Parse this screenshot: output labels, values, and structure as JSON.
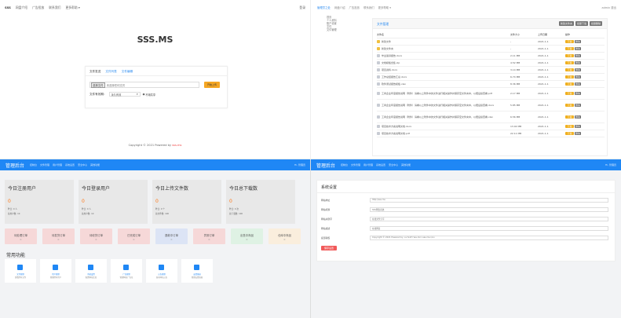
{
  "home": {
    "nav": [
      "SSS",
      "网盘介绍",
      "广告投放",
      "联系我们",
      "更多帮助 ▾"
    ],
    "login": "登录",
    "logo": "SSS.MS",
    "tabs": [
      "文件发送",
      "文件列表",
      "文件编辑"
    ],
    "choose_label": "选择文件",
    "file_placeholder": "未选择任何文件",
    "upload_button": "开始上传",
    "expire_label": "文件有效期：",
    "expire_value": "永久有效",
    "share_label": "不用共享",
    "copyright": "Copyright © 2021 Powered by",
    "copyright_link": "sss.ms"
  },
  "files": {
    "nav": [
      "管理员之处",
      "网盘介绍",
      "广告投放",
      "联系我们",
      "更多帮助 ▾"
    ],
    "nav_right": "admin 退出",
    "sidebar": [
      "首页",
      "个人资料",
      "账户设置",
      "",
      "文件",
      "文件管理"
    ],
    "title": "文件管理",
    "buttons": [
      "新建文件夹",
      "批量下载",
      "批量删除"
    ],
    "columns": [
      "文件名",
      "文件大小",
      "上传日期",
      "操作"
    ],
    "rows": [
      {
        "name": "新建文件",
        "size": "-",
        "date": "2021-1-1",
        "folder": true,
        "tall": false
      },
      {
        "name": "新建文件夹",
        "size": "-",
        "date": "2021-1-1",
        "folder": true,
        "tall": false
      },
      {
        "name": "毕业答辩报告.docx",
        "size": "2.11 MB",
        "date": "2021-1-1",
        "folder": false,
        "tall": false
      },
      {
        "name": "文档模板合集.zip",
        "size": "4.52 MB",
        "date": "2021-1-1",
        "folder": false,
        "tall": false
      },
      {
        "name": "项目资料.docx",
        "size": "3.14 MB",
        "date": "2021-1-1",
        "folder": false,
        "tall": false
      },
      {
        "name": "工作总结报告汇总.docx",
        "size": "6.74 MB",
        "date": "2021-1-1",
        "folder": false,
        "tall": false
      },
      {
        "name": "软件测试报告模板.xlsx",
        "size": "8.36 MB",
        "date": "2021-1-1",
        "folder": false,
        "tall": false
      },
      {
        "name": "工商企业年度报告说明（附件）请看以上附件中的文件进行相关操作并保存至文件夹中，以便后续查看.pdf",
        "size": "2.17 MB",
        "date": "2021-1-1",
        "folder": false,
        "tall": true
      },
      {
        "name": "工商企业年度报告说明（附件）请看以上附件中的文件进行相关操作并保存至文件夹中，以便后续查看.docx",
        "size": "5.85 MB",
        "date": "2021-1-1",
        "folder": false,
        "tall": true
      },
      {
        "name": "工商企业年度报告说明（附件）请看以上附件中的文件进行相关操作并保存至文件夹中，以便后续查看.xlsx",
        "size": "6.56 MB",
        "date": "2021-1-1",
        "folder": false,
        "tall": true
      },
      {
        "name": "项目技术方案说明文档.docx",
        "size": "13.02 MB",
        "date": "2021-1-1",
        "folder": false,
        "tall": false
      },
      {
        "name": "项目技术方案说明文档.pdf",
        "size": "22.11 MB",
        "date": "2021-1-1",
        "folder": false,
        "tall": false
      }
    ],
    "op_download": "下载",
    "op_delete": "删除"
  },
  "dashboard": {
    "brand": "管理后台",
    "menu": [
      "控制台",
      "文件管理",
      "用户管理",
      "系统设置",
      "安全中心",
      "其他功能"
    ],
    "user": "Hi, 管理员",
    "stats": [
      {
        "title": "今日注册用户",
        "value": "0",
        "s1": "昨日: 0 人",
        "s2": "总用户数: 10"
      },
      {
        "title": "今日登录用户",
        "value": "0",
        "s1": "昨日: 0 人",
        "s2": "总用户数: 10"
      },
      {
        "title": "今日上传文件数",
        "value": "0",
        "s1": "昨日: 0 个",
        "s2": "总文件数: 100"
      },
      {
        "title": "今日总下载数",
        "value": "0",
        "s1": "昨日: 0 次",
        "s2": "总下载数: 100"
      }
    ],
    "orders": [
      {
        "label": "待处理订单",
        "n": "0",
        "color": "#f6d8d8"
      },
      {
        "label": "待发货订单",
        "n": "0",
        "color": "#f6d8d8"
      },
      {
        "label": "待收货订单",
        "n": "0",
        "color": "#f6d8d8"
      },
      {
        "label": "已完成订单",
        "n": "0",
        "color": "#f6d8d8"
      },
      {
        "label": "退款中订单",
        "n": "0",
        "color": "#dce4f5"
      },
      {
        "label": "异常订单",
        "n": "0",
        "color": "#f6d8d8"
      },
      {
        "label": "出售中商品",
        "n": "0",
        "color": "#dff2e4"
      },
      {
        "label": "仓库中商品",
        "n": "0",
        "color": "#faeedd"
      }
    ],
    "func_title": "常用功能",
    "funcs": [
      {
        "a": "文件管理",
        "b": "查看所有文件"
      },
      {
        "a": "用户管理",
        "b": "管理所有用户"
      },
      {
        "a": "系统设置",
        "b": "配置网站信息"
      },
      {
        "a": "广告管理",
        "b": "管理网站广告位"
      },
      {
        "a": "公告管理",
        "b": "发布网站公告"
      },
      {
        "a": "友情链接",
        "b": "管理友情链接"
      }
    ]
  },
  "settings": {
    "brand": "管理后台",
    "menu": [
      "控制台",
      "文件管理",
      "用户管理",
      "系统设置",
      "安全中心",
      "其他功能"
    ],
    "user": "Hi, 管理员",
    "title": "系统设置",
    "fields": [
      {
        "label": "网站地址",
        "value": "http://sss.ms"
      },
      {
        "label": "网站标题",
        "value": "SSS网盘系统"
      },
      {
        "label": "网站关键字",
        "value": "在线文件分享"
      },
      {
        "label": "网站描述",
        "value": "在线网盘"
      },
      {
        "label": "底部版权",
        "value": "Copyright © 2021 Powered by <a href='sss.ms'>sss.ms</a>"
      }
    ],
    "save": "保存设置"
  }
}
